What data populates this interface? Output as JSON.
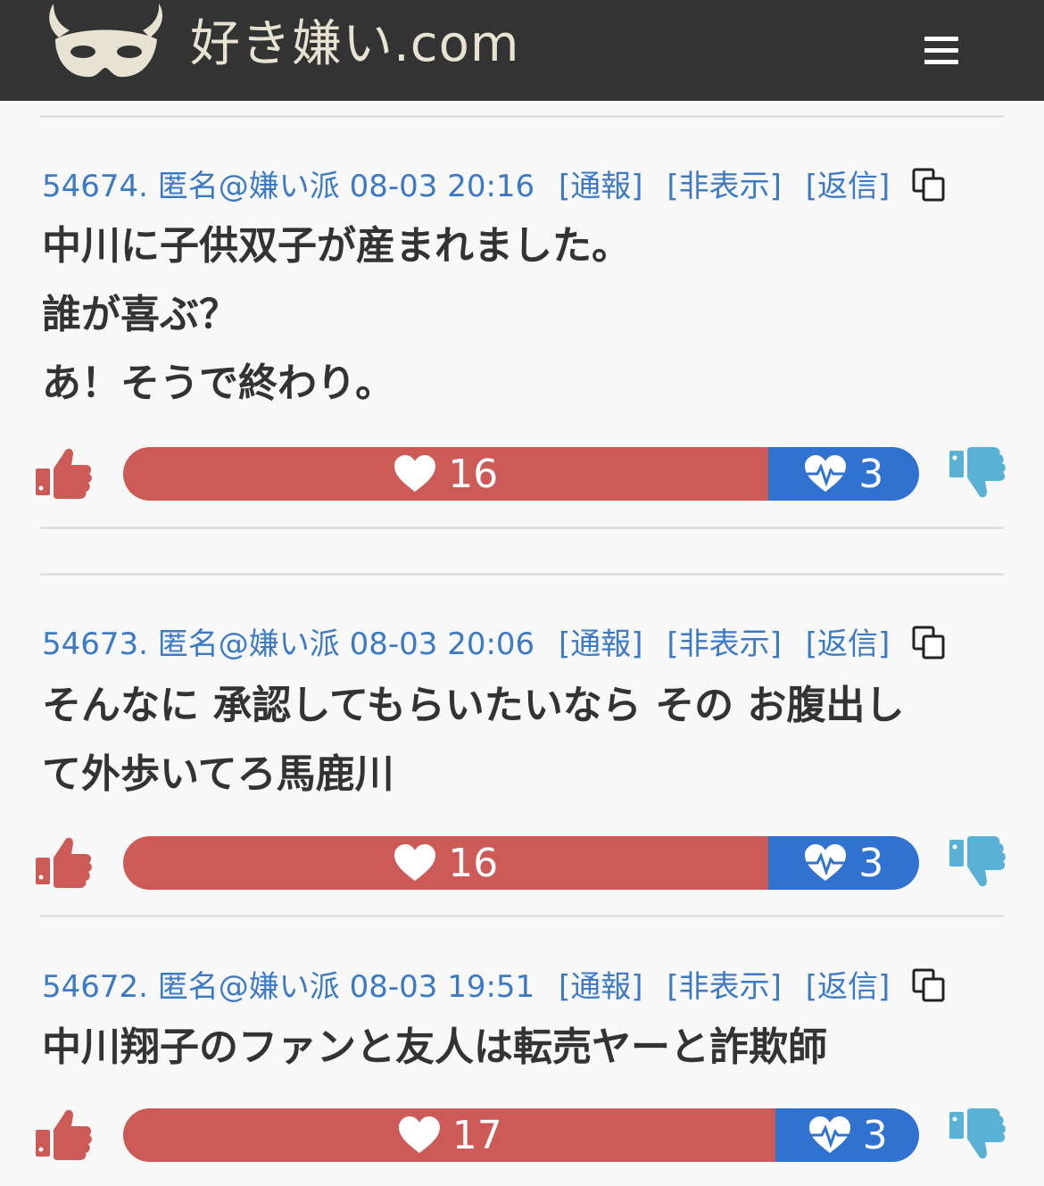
{
  "header": {
    "site_name": "好き嫌い.com",
    "logo_icon": "mask-logo-icon",
    "menu_icon": "hamburger-menu-icon"
  },
  "colors": {
    "header_bg": "#333333",
    "link": "#3d7ac4",
    "like": "#cc5b57",
    "dislike": "#2f72d0",
    "thumb_up": "#cc5b57",
    "thumb_down": "#5ab1d6"
  },
  "comments": [
    {
      "number": "54674.",
      "author": "匿名@嫌い派",
      "datetime": "08-03 20:16",
      "report": "[通報]",
      "hide": "[非表示]",
      "reply": "[返信]",
      "lines": [
        "中川に子供双子が産まれました。",
        "誰が喜ぶ？",
        "あ！そうで終わり。"
      ],
      "likes": "16",
      "dislikes": "3",
      "like_ratio": 0.81
    },
    {
      "number": "54673.",
      "author": "匿名@嫌い派",
      "datetime": "08-03 20:06",
      "report": "[通報]",
      "hide": "[非表示]",
      "reply": "[返信]",
      "lines": [
        "そんなに 承認してもらいたいなら その お腹出し",
        "て外歩いてろ馬鹿川"
      ],
      "likes": "16",
      "dislikes": "3",
      "like_ratio": 0.81
    },
    {
      "number": "54672.",
      "author": "匿名@嫌い派",
      "datetime": "08-03 19:51",
      "report": "[通報]",
      "hide": "[非表示]",
      "reply": "[返信]",
      "lines": [
        "中川翔子のファンと友人は転売ヤーと詐欺師"
      ],
      "likes": "17",
      "dislikes": "3",
      "like_ratio": 0.82
    }
  ]
}
